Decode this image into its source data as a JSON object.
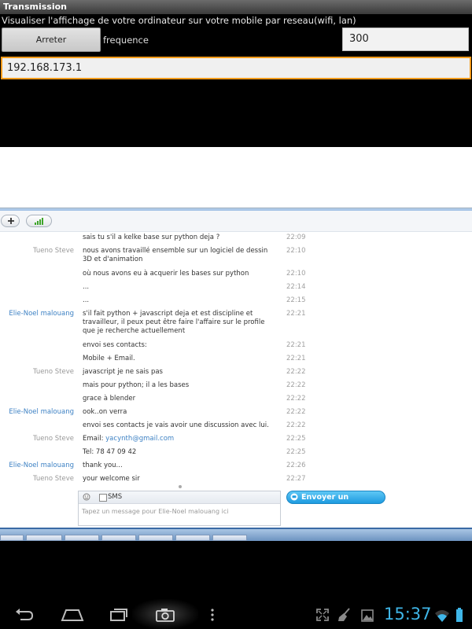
{
  "app": {
    "title": "Transmission",
    "subtitle": "Visualiser l'affichage de votre ordinateur sur votre mobile par reseau(wifi, lan)"
  },
  "controls": {
    "stop_label": "Arreter",
    "frequency_label": "frequence",
    "frequency_value": "300",
    "ip_value": "192.168.173.1"
  },
  "chat": {
    "messages": [
      {
        "sender": "",
        "text": "sais tu s'il a kelke base sur python deja ?",
        "time": "22:09"
      },
      {
        "sender": "Tueno Steve",
        "text": "nous avons travaillé ensemble sur un logiciel de dessin 3D et d'animation",
        "time": "22:10"
      },
      {
        "sender": "",
        "text": "où nous avons eu à acquerir les bases sur python",
        "time": "22:10"
      },
      {
        "sender": "",
        "text": "...",
        "time": "22:14"
      },
      {
        "sender": "",
        "text": "...",
        "time": "22:15"
      },
      {
        "sender": "Elie-Noel malouang",
        "text": "s'il fait python + javascript deja et est discipline et travailleur, il peux peut être faire l'affaire sur le profile que je recherche actuellement",
        "time": "22:21"
      },
      {
        "sender": "",
        "text": "envoi ses contacts:",
        "time": "22:21"
      },
      {
        "sender": "",
        "text": "Mobile + Email.",
        "time": "22:21"
      },
      {
        "sender": "Tueno Steve",
        "text": "javascript je ne sais pas",
        "time": "22:22"
      },
      {
        "sender": "",
        "text": "mais pour python; il a les bases",
        "time": "22:22"
      },
      {
        "sender": "",
        "text": "grace à blender",
        "time": "22:22"
      },
      {
        "sender": "Elie-Noel malouang",
        "text": "ook..on verra",
        "time": "22:22"
      },
      {
        "sender": "",
        "text": "envoi ses contacts je vais avoir une discussion avec lui.",
        "time": "22:22"
      },
      {
        "sender": "Tueno Steve",
        "text": "Email:",
        "link": "yacynth@gmail.com",
        "time": "22:25"
      },
      {
        "sender": "",
        "text": "Tel: 78 47 09 42",
        "time": "22:25"
      },
      {
        "sender": "Elie-Noel malouang",
        "text": "thank you...",
        "time": "22:26"
      },
      {
        "sender": "Tueno Steve",
        "text": "your welcome sir",
        "time": "22:27"
      }
    ],
    "sms_label": "SMS",
    "input_placeholder": "Tapez un message pour Elie-Noel malouang ici",
    "send_label": "Envoyer un message"
  },
  "status": {
    "clock": "15:37"
  },
  "colors": {
    "accent_orange": "#f39b1b",
    "link_blue": "#3e82c4",
    "clock_blue": "#3fb6e8"
  },
  "icons": {
    "toolbar": [
      "add-icon",
      "signal-bars-icon"
    ],
    "nav": [
      "back-icon",
      "home-icon",
      "recent-apps-icon",
      "camera-icon",
      "menu-dots-icon"
    ],
    "status": [
      "fullscreen-icon",
      "broom-icon",
      "image-icon",
      "wifi-icon",
      "battery-icon"
    ]
  }
}
